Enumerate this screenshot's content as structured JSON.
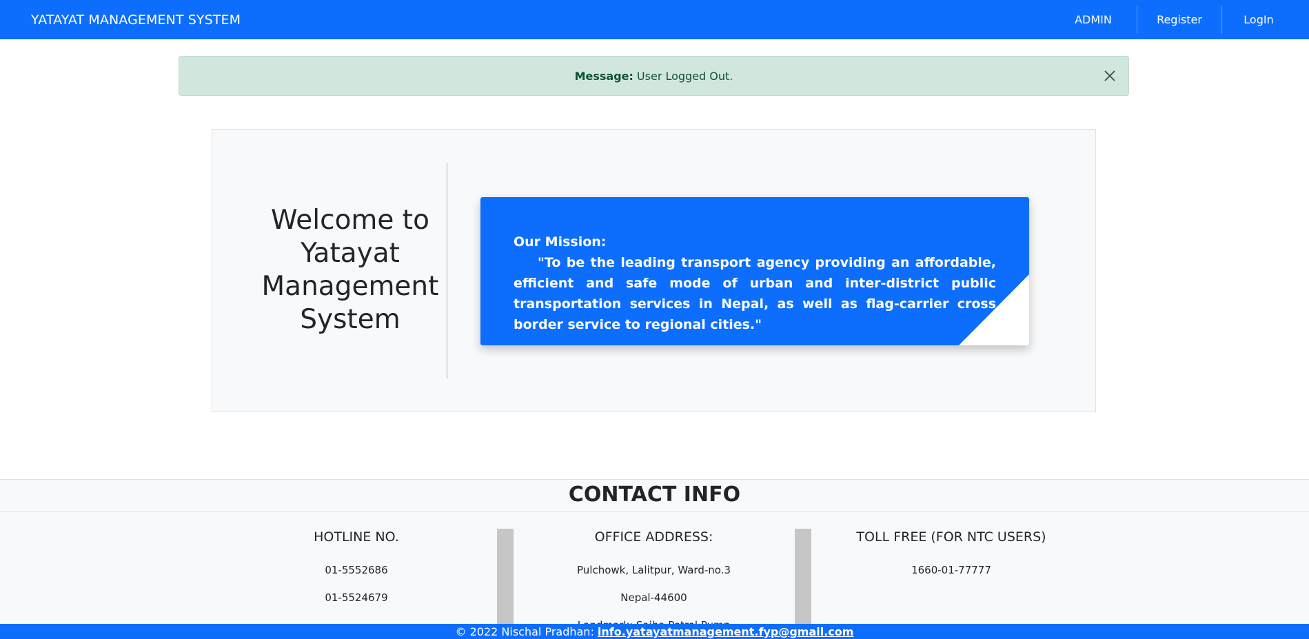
{
  "navbar": {
    "brand": "YATAYAT MANAGEMENT SYSTEM",
    "links": [
      {
        "label": "ADMIN"
      },
      {
        "label": "Register"
      },
      {
        "label": "LogIn"
      }
    ]
  },
  "alert": {
    "label": "Message:",
    "text": "User Logged Out."
  },
  "hero": {
    "welcome": "Welcome to Yatayat Management System",
    "mission_title": "Our Mission:",
    "mission_text": "\"To be the leading transport agency providing an affordable, efficient and safe mode of urban and inter-district public transportation services in Nepal, as well as flag-carrier cross border service to regional cities.\""
  },
  "contact": {
    "title": "CONTACT INFO",
    "hotline": {
      "heading": "HOTLINE NO.",
      "lines": [
        "01-5552686",
        "01-5524679"
      ]
    },
    "office": {
      "heading": "OFFICE ADDRESS:",
      "lines": [
        "Pulchowk, Lalitpur, Ward-no.3",
        "Nepal-44600",
        "Landmark: Sajha Petrol Pump"
      ]
    },
    "toll_free": {
      "heading": "TOLL FREE (FOR NTC USERS)",
      "lines": [
        "1660-01-77777"
      ]
    }
  },
  "footer": {
    "copyright": "© 2022 Nischal Pradhan:",
    "email": "info.yatayatmanagement.fyp@gmail.com"
  },
  "colors": {
    "primary": "#0d6efd",
    "alert_bg": "#d1e7dd",
    "alert_text": "#0f5132",
    "light_bg": "#f8f9fa"
  }
}
